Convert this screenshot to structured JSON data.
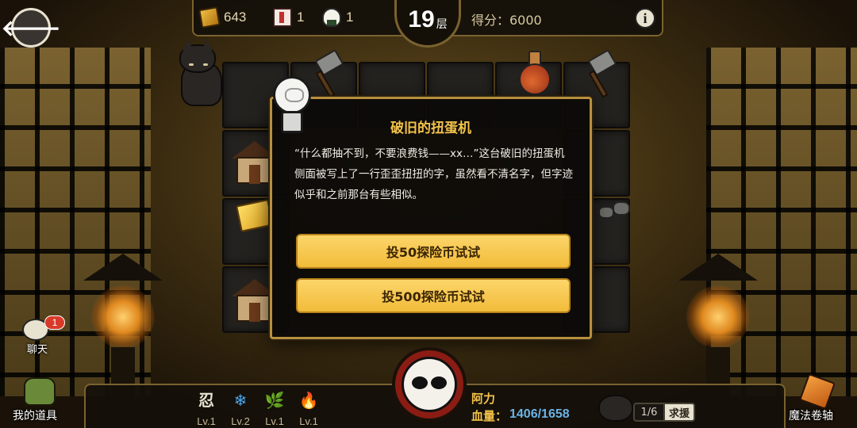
{
  "topbar": {
    "coins": "643",
    "scrolls": "1",
    "onigiri": "1",
    "floor_number": "19",
    "floor_unit": "层",
    "score": "得分：6000",
    "info_label": "i"
  },
  "back_label": "🡐",
  "dialog": {
    "title": "破旧的扭蛋机",
    "text": "“什么都抽不到，不要浪费钱——xx…”这台破旧的扭蛋机侧面被写上了一行歪歪扭扭的字，虽然看不清名字，但字迹似乎和之前那台有些相似。",
    "option1": "投50探险币试试",
    "option2": "投500探险币试试"
  },
  "chat": {
    "label": "聊天",
    "unread": "1"
  },
  "bag_label": "我的道具",
  "magic_scroll_label": "魔法卷轴",
  "skills": [
    {
      "glyph": "忍",
      "level": "Lv.1",
      "color": "#e8e2d0"
    },
    {
      "glyph": "❄",
      "level": "Lv.2",
      "color": "#4aa8f0"
    },
    {
      "glyph": "🌿",
      "level": "Lv.1",
      "color": "#e04848"
    },
    {
      "glyph": "🔥",
      "level": "Lv.1",
      "color": "#e04838"
    }
  ],
  "character": {
    "name": "阿力",
    "hp_label": "血量：",
    "hp_value": "1406/1658"
  },
  "helper": {
    "count": "1/6",
    "assist_label": "求援"
  },
  "colors": {
    "accent_gold": "#f2c24a",
    "button_gold": "#fcd56a",
    "hp_blue": "#6ab4e8",
    "border_gold": "#b8903e"
  }
}
